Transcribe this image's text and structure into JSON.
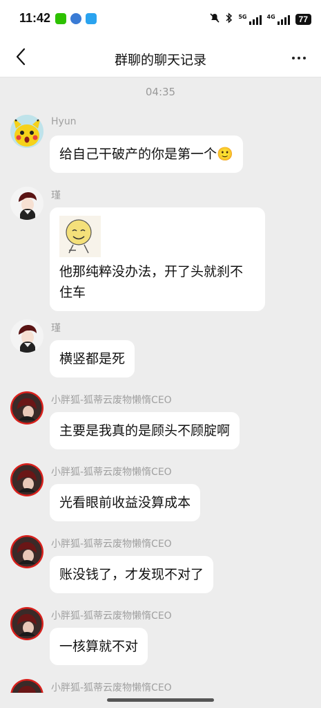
{
  "status_bar": {
    "time": "11:42",
    "net_label_1": "5G",
    "net_label_2": "4G",
    "battery": "77"
  },
  "header": {
    "title": "群聊的聊天记录",
    "back_icon": "chevron-left-icon",
    "more_icon": "more-horizontal-icon"
  },
  "timestamp": "04:35",
  "messages": [
    {
      "sender": "Hyun",
      "text": "给自己干破产的你是第一个",
      "emoji": "🙂"
    },
    {
      "sender": "瑾",
      "text": "他那纯粹没办法，开了头就刹不住车",
      "sticker": "smiley-sticker"
    },
    {
      "sender": "瑾",
      "text": "横竖都是死"
    },
    {
      "sender": "小胖狐-狐蒂云废物懒惰CEO",
      "text": "主要是我真的是顾头不顾腚啊"
    },
    {
      "sender": "小胖狐-狐蒂云废物懒惰CEO",
      "text": "光看眼前收益没算成本"
    },
    {
      "sender": "小胖狐-狐蒂云废物懒惰CEO",
      "text": "账没钱了，才发现不对了"
    },
    {
      "sender": "小胖狐-狐蒂云废物懒惰CEO",
      "text": "一核算就不对"
    },
    {
      "sender": "小胖狐-狐蒂云废物懒惰CEO"
    }
  ]
}
